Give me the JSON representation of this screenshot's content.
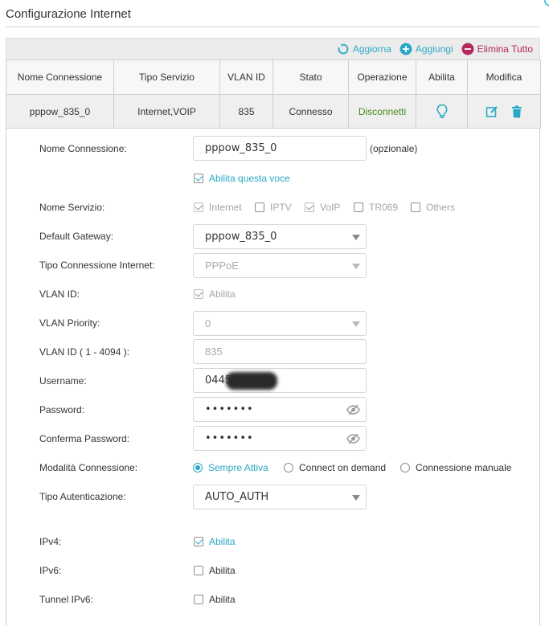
{
  "page": {
    "title": "Configurazione Internet"
  },
  "toolbar": {
    "refresh": "Aggiorna",
    "add": "Aggiungi",
    "delete_all": "Elimina Tutto"
  },
  "table": {
    "headers": [
      "Nome Connessione",
      "Tipo Servizio",
      "VLAN ID",
      "Stato",
      "Operazione",
      "Abilita",
      "Modifica"
    ],
    "row": {
      "name": "pppow_835_0",
      "service": "Internet,VOIP",
      "vlan": "835",
      "status": "Connesso",
      "operation": "Disconnetti"
    }
  },
  "form": {
    "conn_name": {
      "label": "Nome Connessione:",
      "value": "pppow_835_0",
      "note": "(opzionale)"
    },
    "enable_entry": {
      "label": "Abilita questa voce",
      "checked": true
    },
    "service_name": {
      "label": "Nome Servizio:",
      "options": [
        {
          "label": "Internet",
          "checked": true
        },
        {
          "label": "IPTV",
          "checked": false
        },
        {
          "label": "VoIP",
          "checked": true
        },
        {
          "label": "TR069",
          "checked": false
        },
        {
          "label": "Others",
          "checked": false
        }
      ]
    },
    "default_gateway": {
      "label": "Default Gateway:",
      "value": "pppow_835_0"
    },
    "conn_type": {
      "label": "Tipo Connessione Internet:",
      "value": "PPPoE"
    },
    "vlan_id_enable": {
      "label": "VLAN ID:",
      "option": "Abilita",
      "checked": true
    },
    "vlan_priority": {
      "label": "VLAN Priority:",
      "value": "0"
    },
    "vlan_id": {
      "label": "VLAN ID ( 1 - 4094 ):",
      "value": "835"
    },
    "username": {
      "label": "Username:",
      "value": "0445"
    },
    "password": {
      "label": "Password:",
      "value": "•••••••"
    },
    "confirm_password": {
      "label": "Conferma Password:",
      "value": "•••••••"
    },
    "conn_mode": {
      "label": "Modalità Connessione:",
      "options": [
        {
          "label": "Sempre Attiva",
          "selected": true
        },
        {
          "label": "Connect on demand",
          "selected": false
        },
        {
          "label": "Connessione manuale",
          "selected": false
        }
      ]
    },
    "auth_type": {
      "label": "Tipo Autenticazione:",
      "value": "AUTO_AUTH"
    },
    "ipv4": {
      "label": "IPv4:",
      "option": "Abilita",
      "checked": true
    },
    "ipv6": {
      "label": "IPv6:",
      "option": "Abilita",
      "checked": false
    },
    "tunnel_ipv6": {
      "label": "Tunnel IPv6:",
      "option": "Abilita",
      "checked": false
    }
  },
  "colors": {
    "accent": "#2aa9c7",
    "delete": "#b5285e",
    "link_green": "#4a8a1c"
  }
}
